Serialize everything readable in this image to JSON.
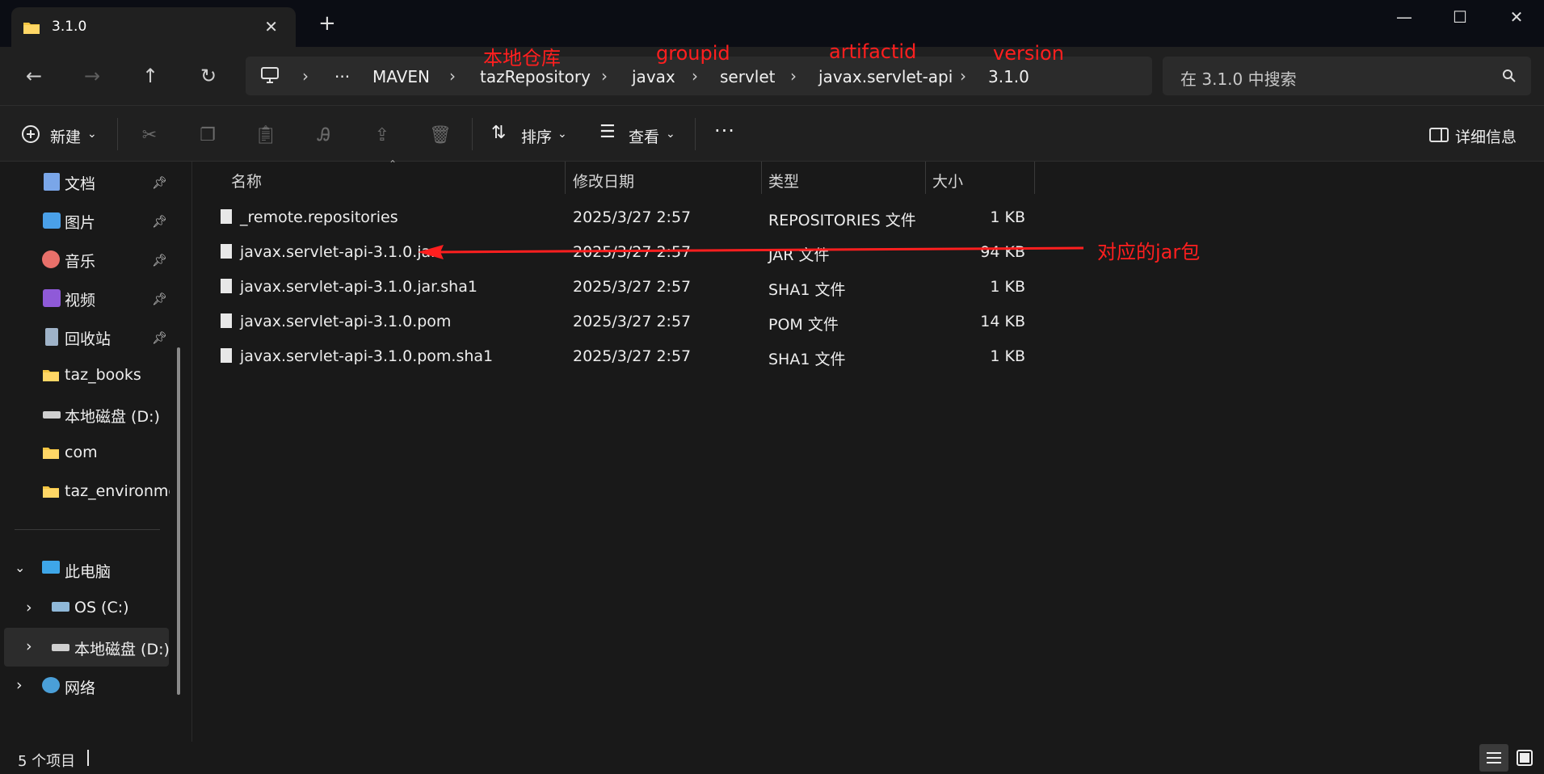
{
  "tab": {
    "title": "3.1.0",
    "new_tab": "+"
  },
  "window": {
    "minimize": "—",
    "maximize": "☐",
    "close": "✕"
  },
  "nav": {
    "back": "←",
    "forward": "→",
    "up": "↑",
    "refresh": "↻"
  },
  "address": {
    "overflow": "···",
    "crumbs": [
      "MAVEN",
      "tazRepository",
      "javax",
      "servlet",
      "javax.servlet-api",
      "3.1.0"
    ],
    "separator": "›"
  },
  "search": {
    "placeholder": "在 3.1.0 中搜索"
  },
  "annotations": {
    "local_repo": "本地仓库",
    "groupid": "groupid",
    "artifactid": "artifactid",
    "version": "version",
    "jar_note": "对应的jar包"
  },
  "toolbar": {
    "new": "新建",
    "sort": "排序",
    "view": "查看",
    "more": "···",
    "details": "详细信息"
  },
  "sidebar": {
    "quick": [
      {
        "label": "文档",
        "pinned": true
      },
      {
        "label": "图片",
        "pinned": true
      },
      {
        "label": "音乐",
        "pinned": true
      },
      {
        "label": "视频",
        "pinned": true
      },
      {
        "label": "回收站",
        "pinned": true
      },
      {
        "label": "taz_books",
        "pinned": false
      },
      {
        "label": "本地磁盘 (D:)",
        "pinned": false
      },
      {
        "label": "com",
        "pinned": false
      },
      {
        "label": "taz_environmer",
        "pinned": false
      }
    ],
    "this_pc": "此电脑",
    "os_c": "OS (C:)",
    "local_d": "本地磁盘 (D:)",
    "network": "网络"
  },
  "columns": {
    "name": "名称",
    "modified": "修改日期",
    "type": "类型",
    "size": "大小"
  },
  "files": [
    {
      "name": "_remote.repositories",
      "modified": "2025/3/27 2:57",
      "type": "REPOSITORIES 文件",
      "size": "1 KB"
    },
    {
      "name": "javax.servlet-api-3.1.0.jar",
      "modified": "2025/3/27 2:57",
      "type": "JAR 文件",
      "size": "94 KB"
    },
    {
      "name": "javax.servlet-api-3.1.0.jar.sha1",
      "modified": "2025/3/27 2:57",
      "type": "SHA1 文件",
      "size": "1 KB"
    },
    {
      "name": "javax.servlet-api-3.1.0.pom",
      "modified": "2025/3/27 2:57",
      "type": "POM 文件",
      "size": "14 KB"
    },
    {
      "name": "javax.servlet-api-3.1.0.pom.sha1",
      "modified": "2025/3/27 2:57",
      "type": "SHA1 文件",
      "size": "1 KB"
    }
  ],
  "status": {
    "count": "5 个项目"
  },
  "colors": {
    "annotation": "#ff1f1f",
    "background": "#191919",
    "toolbar": "#202020"
  }
}
